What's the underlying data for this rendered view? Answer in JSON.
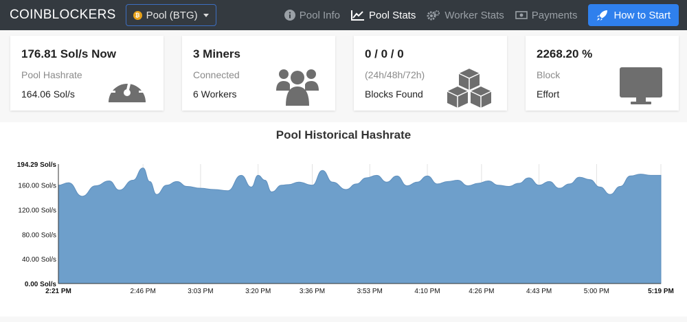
{
  "navbar": {
    "brand": "COINBLOCKERS",
    "pool_selector": "Pool (BTG)",
    "links": [
      {
        "label": "Pool Info",
        "icon": "info-icon",
        "active": false
      },
      {
        "label": "Pool Stats",
        "icon": "chart-line-icon",
        "active": true
      },
      {
        "label": "Worker Stats",
        "icon": "cogs-icon",
        "active": false
      },
      {
        "label": "Payments",
        "icon": "money-icon",
        "active": false
      }
    ],
    "cta_label": "How to Start"
  },
  "cards": [
    {
      "headline": "176.81 Sol/s Now",
      "label": "Pool Hashrate",
      "value": "164.06 Sol/s",
      "icon": "speedometer-icon"
    },
    {
      "headline": "3 Miners",
      "label": "Connected",
      "value": "6 Workers",
      "icon": "users-icon"
    },
    {
      "headline": "0 / 0 / 0",
      "label": "(24h/48h/72h)",
      "value": "Blocks Found",
      "icon": "cubes-icon"
    },
    {
      "headline": "2268.20 %",
      "label": "Block",
      "value": "Effort",
      "icon": "desktop-icon"
    }
  ],
  "chart_title": "Pool Historical Hashrate",
  "chart_data": {
    "type": "area",
    "title": "Pool Historical Hashrate",
    "unit": "Sol/s",
    "ylim": [
      0,
      194.29
    ],
    "yticks": [
      "194.29 Sol/s",
      "160.00 Sol/s",
      "120.00 Sol/s",
      "80.00 Sol/s",
      "40.00 Sol/s",
      "0.00 Sol/s"
    ],
    "ytick_values": [
      194.29,
      160,
      120,
      80,
      40,
      0
    ],
    "xticks": [
      "2:21 PM",
      "2:46 PM",
      "3:03 PM",
      "3:20 PM",
      "3:36 PM",
      "3:53 PM",
      "4:10 PM",
      "4:26 PM",
      "4:43 PM",
      "5:00 PM",
      "5:19 PM"
    ],
    "xtick_minutes": [
      0,
      25,
      42,
      59,
      75,
      92,
      109,
      125,
      142,
      159,
      178
    ],
    "x_minutes": [
      0,
      3,
      7,
      11,
      15,
      18,
      22,
      25,
      27,
      29,
      32,
      35,
      38,
      42,
      46,
      50,
      54,
      57,
      59,
      61,
      63,
      66,
      68,
      71,
      75,
      78,
      81,
      85,
      88,
      91,
      94,
      97,
      100,
      103,
      106,
      109,
      112,
      115,
      118,
      121,
      124,
      127,
      130,
      133,
      136,
      139,
      142,
      145,
      148,
      151,
      154,
      157,
      160,
      163,
      166,
      169,
      172,
      175,
      178
    ],
    "values": [
      160,
      164,
      142,
      159,
      167,
      152,
      168,
      188,
      166,
      145,
      160,
      166,
      158,
      155,
      153,
      151,
      176,
      157,
      176,
      168,
      149,
      160,
      161,
      165,
      160,
      184,
      165,
      153,
      162,
      172,
      176,
      165,
      175,
      159,
      165,
      175,
      162,
      166,
      168,
      159,
      163,
      167,
      160,
      158,
      163,
      172,
      160,
      166,
      155,
      162,
      173,
      169,
      157,
      145,
      158,
      175,
      178,
      176,
      176
    ]
  }
}
